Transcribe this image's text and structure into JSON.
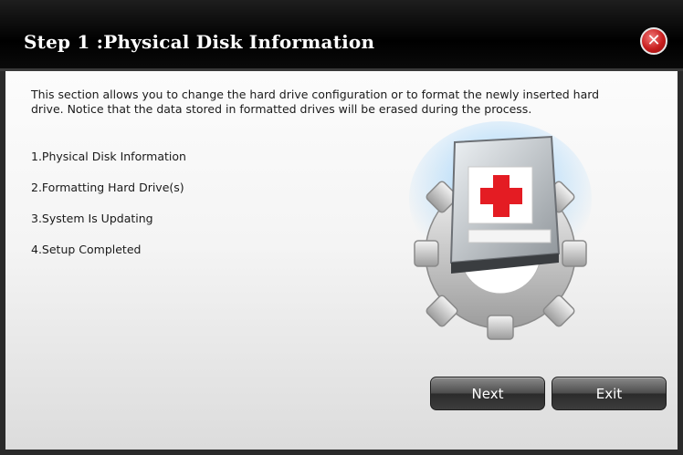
{
  "dialog": {
    "title": "Step 1 :Physical Disk Information",
    "close_glyph": "✕",
    "intro": "This section allows you to change the hard drive configuration or to format the newly inserted hard drive. Notice that the data stored in formatted drives will be erased during the process."
  },
  "steps": [
    "1.Physical Disk Information",
    "2.Formatting Hard Drive(s)",
    "3.System Is Updating",
    "4.Setup Completed"
  ],
  "illustration": {
    "icon": "hard-drive-gear-icon",
    "cross_color": "#e41c23",
    "glow_color": "#4fb2ff",
    "gear_color": "#d8d8d8"
  },
  "buttons": {
    "next_label": "Next",
    "exit_label": "Exit"
  },
  "colors": {
    "title_bar": "#000000",
    "close_button": "#c81e1e"
  }
}
